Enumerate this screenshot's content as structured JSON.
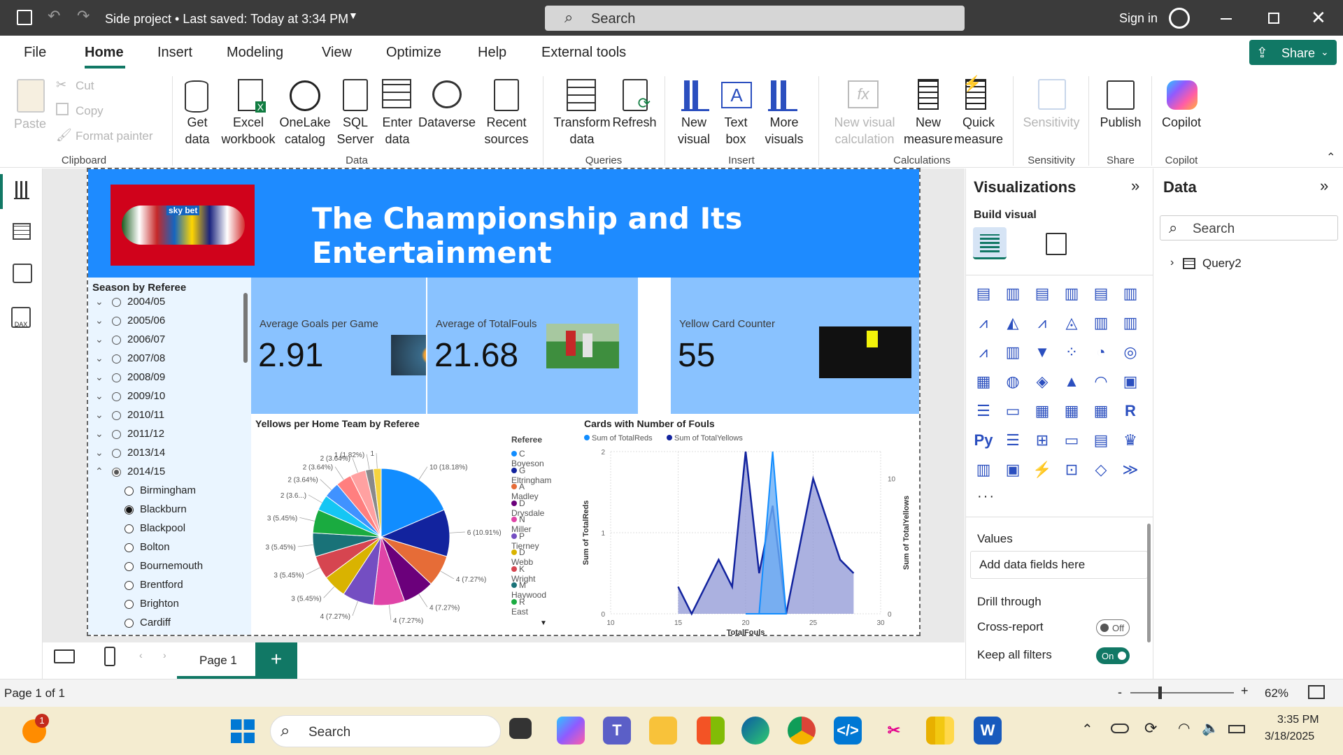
{
  "titlebar": {
    "title": "Side project • Last saved: Today at 3:34 PM",
    "search_placeholder": "Search",
    "signin": "Sign in"
  },
  "menu": [
    "File",
    "Home",
    "Insert",
    "Modeling",
    "View",
    "Optimize",
    "Help",
    "External tools"
  ],
  "share_label": "Share",
  "ribbon": {
    "clipboard": {
      "paste": "Paste",
      "cut": "Cut",
      "copy": "Copy",
      "format_painter": "Format painter",
      "group": "Clipboard"
    },
    "data": {
      "get_data": [
        "Get",
        "data"
      ],
      "excel": [
        "Excel",
        "workbook"
      ],
      "onelake": [
        "OneLake",
        "catalog"
      ],
      "sql": [
        "SQL",
        "Server"
      ],
      "enter": [
        "Enter",
        "data"
      ],
      "dataverse": "Dataverse",
      "recent": [
        "Recent",
        "sources"
      ],
      "group": "Data"
    },
    "queries": {
      "transform": [
        "Transform",
        "data"
      ],
      "refresh": "Refresh",
      "group": "Queries"
    },
    "insert": {
      "new_visual": [
        "New",
        "visual"
      ],
      "text_box": [
        "Text",
        "box"
      ],
      "more_visuals": [
        "More",
        "visuals"
      ],
      "group": "Insert"
    },
    "calculations": {
      "new_visual_calc": [
        "New visual",
        "calculation"
      ],
      "new_measure": [
        "New",
        "measure"
      ],
      "quick_measure": [
        "Quick",
        "measure"
      ],
      "group": "Calculations"
    },
    "sensitivity": {
      "label": "Sensitivity",
      "group": "Sensitivity"
    },
    "share": {
      "publish": "Publish",
      "group": "Share"
    },
    "copilot": {
      "label": "Copilot",
      "group": "Copilot"
    }
  },
  "report": {
    "title": "The Championship and Its Entertainment",
    "logo_text": "sky bet",
    "slicer": {
      "title": "Season by Referee",
      "seasons": [
        "2004/05",
        "2005/06",
        "2006/07",
        "2007/08",
        "2008/09",
        "2009/10",
        "2010/11",
        "2011/12",
        "2013/14",
        "2014/15"
      ],
      "teams": [
        "Birmingham",
        "Blackburn",
        "Blackpool",
        "Bolton",
        "Bournemouth",
        "Brentford",
        "Brighton",
        "Cardiff"
      ],
      "selected_team": "Blackburn"
    },
    "kpis": [
      {
        "label": "Average Goals per Game",
        "value": "2.91"
      },
      {
        "label": "Average of TotalFouls",
        "value": "21.68"
      },
      {
        "label": "Yellow Card Counter",
        "value": "55"
      }
    ]
  },
  "chart_data": [
    {
      "type": "pie",
      "title": "Yellows per Home Team by Referee",
      "legend_title": "Referee",
      "legend": [
        "C Boyeson",
        "G Eltringham",
        "A Madley",
        "D Drysdale",
        "N Miller",
        "P Tierney",
        "D Webb",
        "K Wright",
        "M Haywood",
        "R East"
      ],
      "values": [
        10,
        6,
        4,
        4,
        4,
        4,
        3,
        3,
        3,
        3,
        2,
        2,
        2,
        2,
        1,
        1
      ],
      "labels": [
        "10 (18.18%)",
        "6 (10.91%)",
        "4 (7.27%)",
        "4 (7.27%)",
        "4 (7.27%)",
        "4 (7.27%)",
        "3 (5.45%)",
        "3 (5.45%)",
        "3 (5.45%)",
        "3 (5.45%)",
        "2 (3.6...)",
        "2 (3.64%)",
        "2 (3.64%)",
        "2 (3.64%)",
        "1 (1.82%)",
        "1"
      ],
      "colors": [
        "#118dff",
        "#12239e",
        "#e66c37",
        "#6b007b",
        "#e044a7",
        "#744ec2",
        "#d9b300",
        "#d64550",
        "#197278",
        "#1aab40",
        "#15c6f4",
        "#4092ff",
        "#ff7f7f",
        "#ffa1a1",
        "#8a8a8a",
        "#f5d33f"
      ]
    },
    {
      "type": "area",
      "title": "Cards with Number of Fouls",
      "legend": [
        "Sum of TotalReds",
        "Sum of TotalYellows"
      ],
      "xlabel": "TotalFouls",
      "ylabel_left": "Sum of TotalReds",
      "ylabel_right": "Sum of TotalYellows",
      "x_ticks": [
        10,
        15,
        20,
        25,
        30
      ],
      "y_left_ticks": [
        0,
        1,
        2
      ],
      "y_right_ticks": [
        0,
        5,
        10
      ],
      "xlim": [
        10,
        30
      ],
      "ylim_left": [
        0,
        2
      ],
      "ylim_right": [
        0,
        12
      ],
      "series": [
        {
          "name": "Sum of TotalReds",
          "x": [
            20,
            21,
            22,
            23
          ],
          "values": [
            0,
            0,
            2,
            0
          ],
          "color": "#118dff"
        },
        {
          "name": "Sum of TotalYellows",
          "x": [
            15,
            16,
            18,
            19,
            20,
            21,
            22,
            23,
            25,
            26,
            27,
            28
          ],
          "values": [
            2,
            0,
            4,
            2,
            12,
            3,
            8,
            0,
            10,
            7,
            4,
            3
          ],
          "color": "#12239e"
        }
      ]
    }
  ],
  "visualizations": {
    "title": "Visualizations",
    "build_visual": "Build visual",
    "values_label": "Values",
    "add_fields": "Add data fields here",
    "drill_through": "Drill through",
    "cross_report": "Cross-report",
    "cross_report_state": "Off",
    "keep_filters": "Keep all filters",
    "keep_filters_state": "On"
  },
  "data_pane": {
    "title": "Data",
    "search_placeholder": "Search",
    "query": "Query2"
  },
  "pages": {
    "current": "Page 1",
    "status": "Page 1 of 1",
    "zoom": "62%"
  },
  "taskbar": {
    "search": "Search",
    "time": "3:35 PM",
    "date": "3/18/2025",
    "notification_count": "1"
  },
  "colors": {
    "accent": "#117865",
    "banner": "#1e8bff",
    "kpi": "#89c2ff"
  }
}
